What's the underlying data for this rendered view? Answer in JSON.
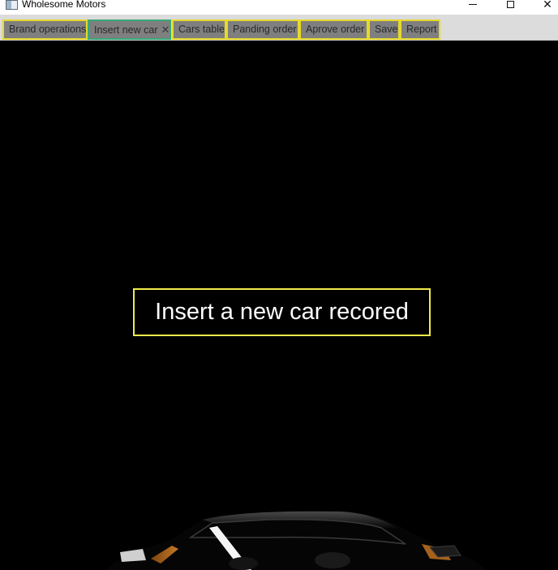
{
  "window": {
    "title": "Wholesome Motors",
    "icon": "app-window-icon",
    "controls": {
      "minimize_icon": "minimize-icon",
      "maximize_icon": "maximize-icon",
      "close_glyph": "✕"
    }
  },
  "tabs": [
    {
      "label": "Brand operations",
      "active": false
    },
    {
      "label": "Insert new car",
      "active": true,
      "close_glyph": "✕"
    },
    {
      "label": "Cars table",
      "active": false
    },
    {
      "label": "Panding order",
      "active": false
    },
    {
      "label": "Aprove order",
      "active": false
    },
    {
      "label": "Save",
      "active": false
    },
    {
      "label": "Report",
      "active": false
    }
  ],
  "main": {
    "heading": "Insert a new car recored",
    "background_image": "sports-car-silhouette"
  },
  "colors": {
    "tab_border": "#e6d92a",
    "active_tab_border": "#3aa87a",
    "tab_bg": "#7f7f7f",
    "heading_border": "#f2ea4a",
    "content_bg": "#000000"
  }
}
